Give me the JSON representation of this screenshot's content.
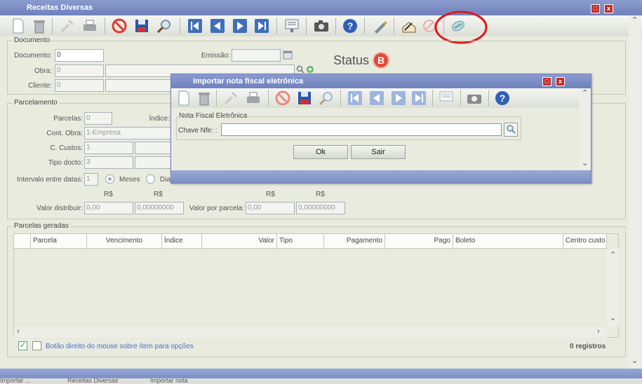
{
  "main_window": {
    "title": "Receitas Diversas",
    "status_label": "Status",
    "status_badge": "B"
  },
  "toolbar": {
    "icons": [
      "new-document-icon",
      "trash-icon",
      "tools-icon",
      "print-icon",
      "cancel-icon",
      "save-icon",
      "search-icon",
      "first-record-icon",
      "prev-record-icon",
      "next-record-icon",
      "last-record-icon",
      "report-icon",
      "camera-icon",
      "help-icon",
      "pen-icon",
      "sign-icon",
      "block-icon",
      "import-nfe-icon"
    ]
  },
  "documento_group": {
    "legend": "Documento",
    "documento_label": "Documento:",
    "documento_value": "0",
    "emissao_label": "Emissão:",
    "emissao_value": "",
    "obra_label": "Obra:",
    "obra_value": "0",
    "cliente_label": "Cliente:",
    "cliente_value": "0"
  },
  "parcelamento_group": {
    "legend": "Parcelamento",
    "parcelas_label": "Parcelas:",
    "parcelas_value": "0",
    "indice_label": "Índice:",
    "cont_obra_label": "Cont. Obra:",
    "cont_obra_value": "1-Empresa",
    "c_custos_label": "C. Custos:",
    "c_custos_value": "1",
    "tipo_docto_label": "Tipo docto:",
    "tipo_docto_value": "3",
    "intervalo_label": "Intervalo entre datas:",
    "intervalo_value": "1",
    "radio_meses": "Meses",
    "radio_dias": "Dia",
    "currency_1": "R$",
    "currency_2": "R$",
    "currency_3": "R$",
    "currency_4": "R$",
    "valor_distribuir_label": "Valor distribuir:",
    "valor_distribuir_value": "0,00",
    "valor_distribuir_index": "0,00000000",
    "valor_parcela_label": "Valor por parcela:",
    "valor_parcela_value": "0,00",
    "valor_parcela_index": "0,00000000"
  },
  "parcelas_geradas": {
    "legend": "Parcelas geradas",
    "columns": [
      "Parcela",
      "Vencimento",
      "Índice",
      "Valor",
      "Tipo",
      "Pagamento",
      "Pago",
      "Boleto",
      "Centro custo"
    ],
    "footer_hint": "Botão direito do mouse sobre ítem para opções",
    "record_count": "0 registros"
  },
  "dialog": {
    "title": "Importar nota fiscal eletrônica",
    "group_legend": "Nota Fiscal Eletrônica",
    "chave_label": "Chave Nfe: :",
    "chave_value": "",
    "ok_button": "Ok",
    "sair_button": "Sair"
  },
  "taskbar": {
    "items": [
      "Importar ...",
      "Receitas Diversas",
      "Importar nota"
    ]
  },
  "annotation_color": "#e0161c"
}
